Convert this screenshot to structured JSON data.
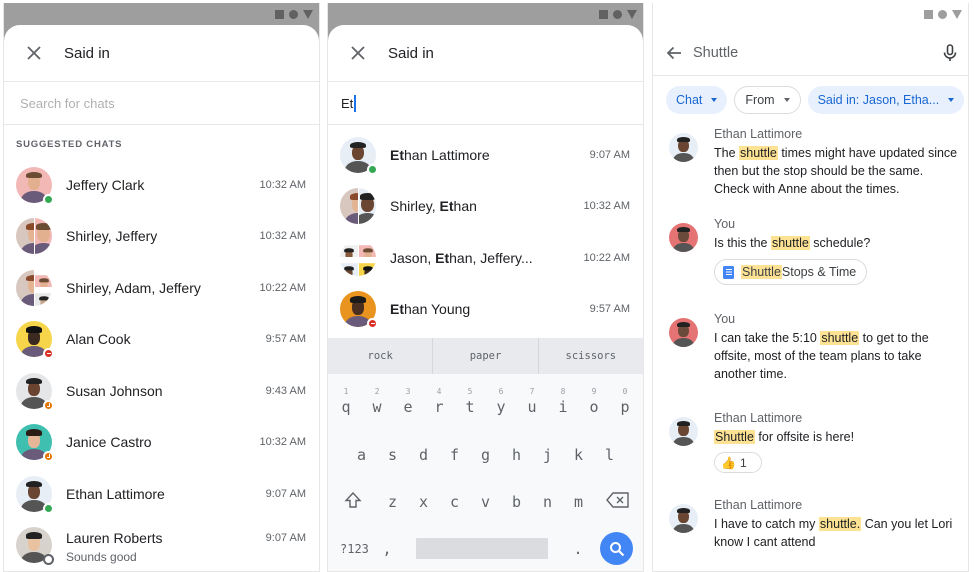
{
  "colors": {
    "online": "#34a853",
    "dnd": "#d93025",
    "away": "#e37400",
    "accent": "#1a73e8",
    "chip_active_bg": "#e8f0fe",
    "highlight": "#fde293"
  },
  "panel1": {
    "title": "Said in",
    "close_icon": "close-icon",
    "search_placeholder": "Search for chats",
    "section_label": "SUGGESTED CHATS",
    "chats": [
      {
        "name": "Jeffery Clark",
        "time": "10:32 AM",
        "status": "online"
      },
      {
        "name": "Shirley, Jeffery",
        "time": "10:32 AM",
        "status": ""
      },
      {
        "name": "Shirley, Adam, Jeffery",
        "time": "10:22 AM",
        "status": ""
      },
      {
        "name": "Alan Cook",
        "time": "9:57 AM",
        "status": "dnd"
      },
      {
        "name": "Susan Johnson",
        "time": "9:43 AM",
        "status": "away"
      },
      {
        "name": "Janice Castro",
        "time": "10:32 AM",
        "status": "away"
      },
      {
        "name": "Ethan Lattimore",
        "time": "9:07 AM",
        "status": "online"
      },
      {
        "name": "Lauren Roberts",
        "time": "9:07 AM",
        "status": "offline",
        "subtitle": "Sounds good"
      }
    ]
  },
  "panel2": {
    "title": "Said in",
    "search_value": "Et",
    "results": [
      {
        "match": "Et",
        "before": "",
        "after": "han Lattimore",
        "time": "9:07 AM",
        "status": "online"
      },
      {
        "match": "Et",
        "before": "Shirley, ",
        "after": "han",
        "time": "10:32 AM",
        "status": ""
      },
      {
        "match": "Et",
        "before": "Jason, ",
        "after": "han, Jeffery...",
        "time": "10:22 AM",
        "status": ""
      },
      {
        "match": "Et",
        "before": "",
        "after": "han Young",
        "time": "9:57 AM",
        "status": "dnd"
      }
    ],
    "suggestions": [
      "rock",
      "paper",
      "scissors"
    ],
    "keyboard": {
      "row1": [
        "q",
        "w",
        "e",
        "r",
        "t",
        "y",
        "u",
        "i",
        "o",
        "p"
      ],
      "row1_nums": [
        "1",
        "2",
        "3",
        "4",
        "5",
        "6",
        "7",
        "8",
        "9",
        "0"
      ],
      "row2": [
        "a",
        "s",
        "d",
        "f",
        "g",
        "h",
        "j",
        "k",
        "l"
      ],
      "row3": [
        "z",
        "x",
        "c",
        "v",
        "b",
        "n",
        "m"
      ],
      "symbols_key": "?123",
      "comma_key": ",",
      "period_key": "."
    }
  },
  "panel3": {
    "query": "Shuttle",
    "chips": [
      {
        "label": "Chat",
        "active": true
      },
      {
        "label": "From",
        "active": false
      },
      {
        "label": "Said in: Jason, Etha...",
        "active": true
      }
    ],
    "messages": [
      {
        "sender": "Ethan Lattimore",
        "parts": [
          "The ",
          "shuttle",
          " times might have updated since then but the stop should be the same. Check with Anne about the times."
        ]
      },
      {
        "sender": "You",
        "parts": [
          "Is this the ",
          "shuttle",
          " schedule?"
        ],
        "attachment": {
          "highlight": "Shuttle",
          "rest": " Stops & Time"
        }
      },
      {
        "sender": "You",
        "parts": [
          "I can take the 5:10 ",
          "shuttle",
          " to get to the offsite, most of the team plans to take another time."
        ]
      },
      {
        "sender": "Ethan Lattimore",
        "parts": [
          "",
          "Shuttle",
          " for offsite is here!"
        ],
        "reaction": {
          "emoji": "thumbs-up",
          "count": "1"
        }
      },
      {
        "sender": "Ethan Lattimore",
        "parts": [
          "I have to catch my ",
          "shuttle.",
          " Can you let Lori know I cant attend"
        ]
      }
    ]
  }
}
